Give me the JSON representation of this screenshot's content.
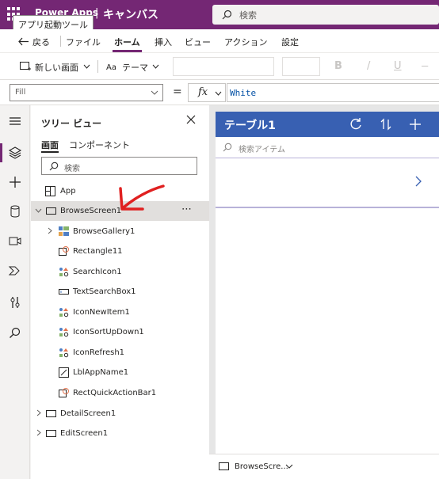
{
  "topbar": {
    "app_name": "Power Apps",
    "separator": "|",
    "canvas_label": "キャンバス",
    "tooltip": "アプリ起動ツール",
    "search_placeholder": "検索"
  },
  "menu": {
    "back": "戻る",
    "items": [
      "ファイル",
      "ホーム",
      "挿入",
      "ビュー",
      "アクション",
      "設定"
    ],
    "active": "ホーム"
  },
  "ribbon": {
    "new_screen": "新しい画面",
    "theme": "テーマ",
    "bold": "B",
    "italic": "/",
    "underline": "U"
  },
  "formula": {
    "property": "Fill",
    "equals": "=",
    "fx": "fx",
    "value": "White"
  },
  "tree": {
    "title": "ツリー ビュー",
    "tabs": [
      "画面",
      "コンポーネント"
    ],
    "search_placeholder": "検索",
    "items": [
      {
        "label": "App",
        "icon": "app-icon",
        "expandable": false,
        "selected": false
      },
      {
        "label": "BrowseScreen1",
        "icon": "screen-icon",
        "expandable": true,
        "expanded": true,
        "selected": true
      },
      {
        "label": "BrowseGallery1",
        "icon": "gallery-icon",
        "expandable": true,
        "expanded": false,
        "selected": false
      },
      {
        "label": "Rectangle11",
        "icon": "rectangle-icon",
        "expandable": false,
        "selected": false
      },
      {
        "label": "SearchIcon1",
        "icon": "icon-control-icon",
        "expandable": false,
        "selected": false
      },
      {
        "label": "TextSearchBox1",
        "icon": "textbox-icon",
        "expandable": false,
        "selected": false
      },
      {
        "label": "IconNewItem1",
        "icon": "icon-control-icon",
        "expandable": false,
        "selected": false
      },
      {
        "label": "IconSortUpDown1",
        "icon": "icon-control-icon",
        "expandable": false,
        "selected": false
      },
      {
        "label": "IconRefresh1",
        "icon": "icon-control-icon",
        "expandable": false,
        "selected": false
      },
      {
        "label": "LblAppName1",
        "icon": "label-icon",
        "expandable": false,
        "selected": false
      },
      {
        "label": "RectQuickActionBar1",
        "icon": "rectangle-icon",
        "expandable": false,
        "selected": false
      },
      {
        "label": "DetailScreen1",
        "icon": "screen-icon",
        "expandable": true,
        "expanded": false,
        "selected": false
      },
      {
        "label": "EditScreen1",
        "icon": "screen-icon",
        "expandable": true,
        "expanded": false,
        "selected": false
      }
    ],
    "more": "⋯"
  },
  "canvas": {
    "header_title": "テーブル1",
    "search_placeholder": "検索アイテム"
  },
  "status": {
    "screen_name": "BrowseScre..."
  },
  "colors": {
    "brand": "#742774",
    "canvas_header": "#3860b2",
    "annotation": "#e02020"
  }
}
